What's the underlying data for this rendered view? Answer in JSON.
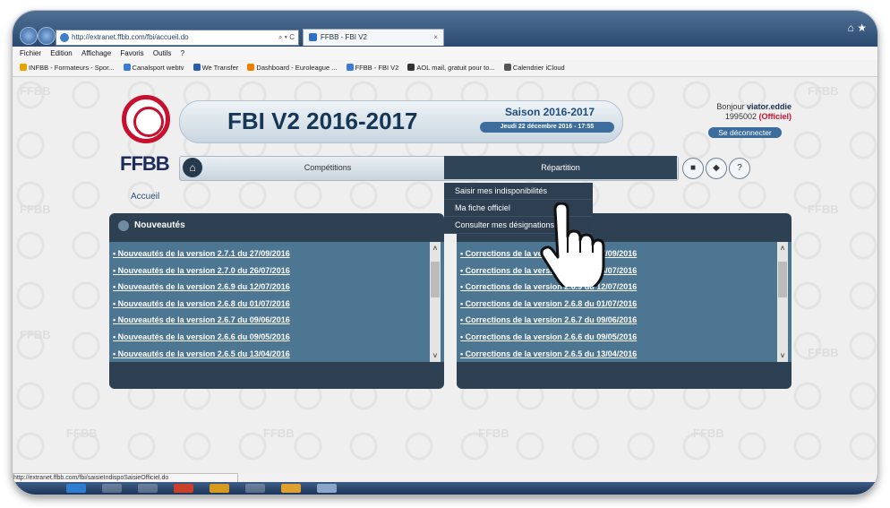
{
  "browser": {
    "address": "http://extranet.ffbb.com/fbi/accueil.do",
    "address_controls": "⌕ ▾ C",
    "tab_title": "FFBB - FBI V2",
    "tab_close": "×",
    "right_icons": "⌂ ★",
    "menu": [
      "Fichier",
      "Edition",
      "Affichage",
      "Favoris",
      "Outils",
      "?"
    ],
    "favorites": [
      "INFBB - Formateurs - Spor...",
      "Canalsport webtv",
      "We Transfer",
      "Dashboard - Euroleague ...",
      "FFBB - FBI V2",
      "AOL mail, gratuit pour to...",
      "Calendrier iCloud"
    ],
    "status_url": "http://extranet.ffbb.com/fbi/saisieIndispoSaisieOfficiel.do"
  },
  "header": {
    "logo_text": "FFBB",
    "title": "FBI V2 2016-2017",
    "season": "Saison 2016-2017",
    "date": "Jeudi 22 décembre 2016 - 17:55",
    "greeting": "Bonjour",
    "username": "viator.eddie",
    "user_id": "1995002",
    "role": "(Officiel)",
    "logout": "Se déconnecter",
    "watermark": "FFBB"
  },
  "nav": {
    "home_icon": "⌂",
    "items": [
      "Compétitions",
      "Répartition"
    ],
    "icon_buttons": [
      "■",
      "◆",
      "?"
    ]
  },
  "dropdown": [
    "Saisir mes indisponibilités",
    "Ma fiche officiel",
    "Consulter mes désignations"
  ],
  "breadcrumb": "Accueil",
  "panels": [
    {
      "title": "Nouveautés",
      "items": [
        "Nouveautés de la version 2.7.1 du 27/09/2016",
        "Nouveautés de la version 2.7.0 du 26/07/2016",
        "Nouveautés de la version 2.6.9 du 12/07/2016",
        "Nouveautés de la version 2.6.8 du 01/07/2016",
        "Nouveautés de la version 2.6.7 du 09/06/2016",
        "Nouveautés de la version 2.6.6 du 09/05/2016",
        "Nouveautés de la version 2.6.5 du 13/04/2016"
      ]
    },
    {
      "title": "",
      "items": [
        "Corrections de la version 2.7.1 du 27/09/2016",
        "Corrections de la version 2.7.0 du 26/07/2016",
        "Corrections de la version 2.6.9 du 12/07/2016",
        "Corrections de la version 2.6.8 du 01/07/2016",
        "Corrections de la version 2.6.7 du 09/06/2016",
        "Corrections de la version 2.6.6 du 09/05/2016",
        "Corrections de la version 2.6.5 du 13/04/2016"
      ]
    }
  ],
  "scroll": {
    "up": "˄",
    "down": "˅"
  },
  "colors": {
    "accent": "#c8102e",
    "nav_dark": "#2f4456",
    "panel_body": "#4d7692"
  }
}
